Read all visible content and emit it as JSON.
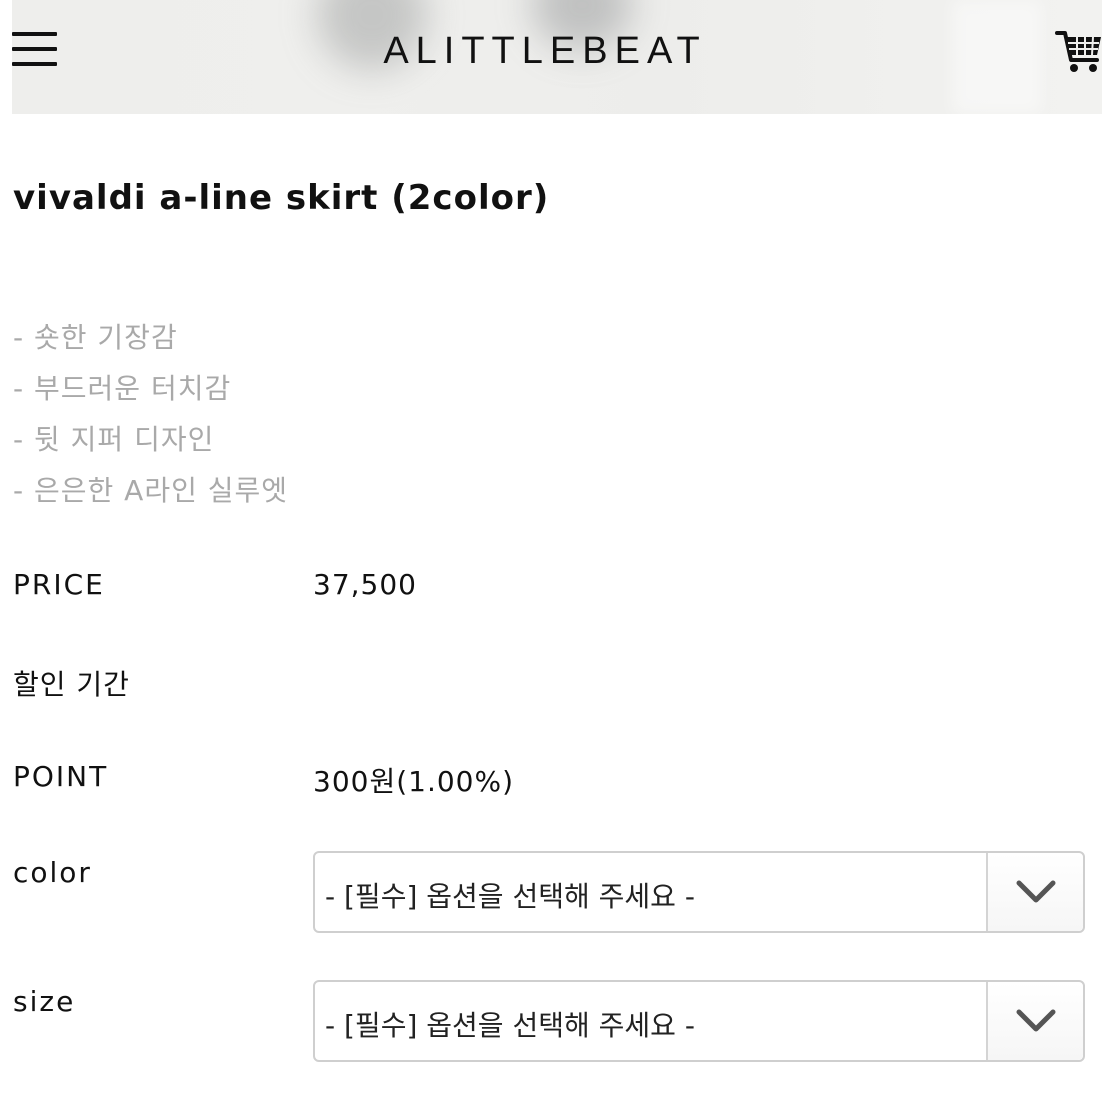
{
  "header": {
    "brand": "ALITTLEBEAT",
    "menu_icon": "hamburger-menu-icon",
    "cart_icon": "shopping-cart-icon"
  },
  "product": {
    "title": "vivaldi a-line skirt (2color)",
    "description": [
      "- 숏한 기장감",
      "- 부드러운 터치감",
      "- 뒷 지퍼 디자인",
      "- 은은한 A라인 실루엣"
    ]
  },
  "details": {
    "price_label": "PRICE",
    "price_value": "37,500",
    "discount_label": "할인 기간",
    "point_label": "POINT",
    "point_value": "300원(1.00%)"
  },
  "options": {
    "color_label": "color",
    "color_selected": "- [필수] 옵션을 선택해 주세요 -",
    "size_label": "size",
    "size_selected": "- [필수] 옵션을 선택해 주세요 -",
    "dropdown_icon": "chevron-down-icon"
  },
  "colors": {
    "text": "#111111",
    "description_text": "#a9a9a9",
    "select_border": "#cfcfcf"
  }
}
